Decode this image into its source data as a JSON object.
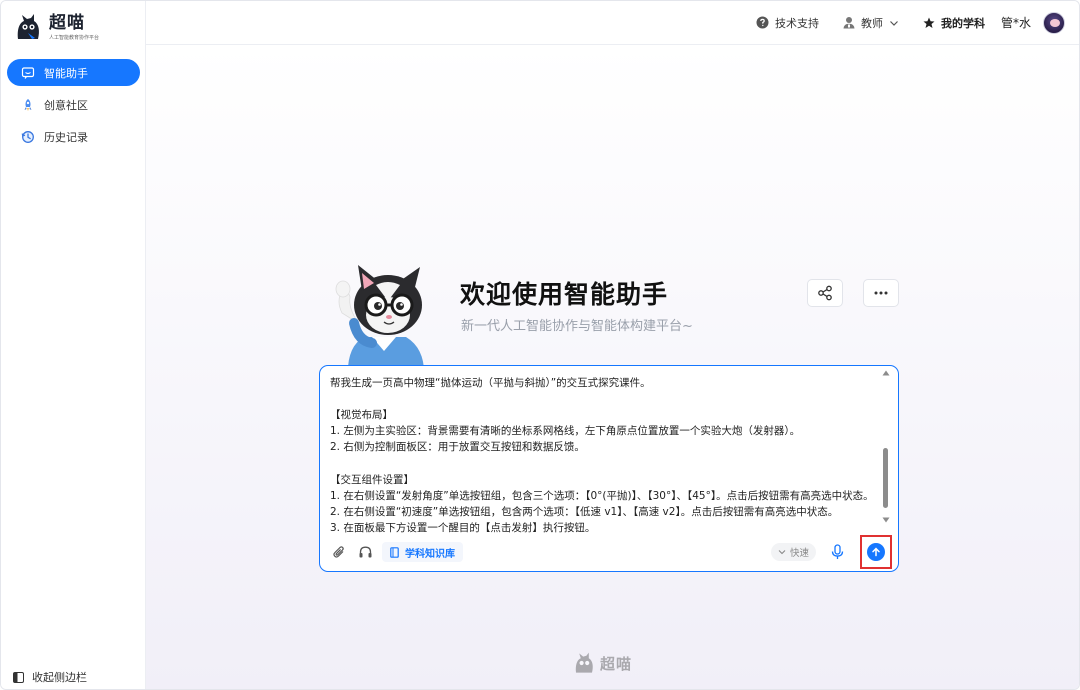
{
  "brand": {
    "name": "超喵",
    "tagline": "人工智能教育协作平台"
  },
  "sidebar": {
    "items": [
      {
        "label": "智能助手",
        "icon": "chat-icon",
        "active": true
      },
      {
        "label": "创意社区",
        "icon": "rocket-icon",
        "active": false
      },
      {
        "label": "历史记录",
        "icon": "history-icon",
        "active": false
      }
    ],
    "collapse_label": "收起侧边栏"
  },
  "topbar": {
    "support_label": "技术支持",
    "role_label": "教师",
    "subject_label": "我的学科",
    "user_name": "管*水"
  },
  "welcome": {
    "title": "欢迎使用智能助手",
    "subtitle": "新一代人工智能协作与智能体构建平台~"
  },
  "composer": {
    "text": "帮我生成一页高中物理“抛体运动（平抛与斜抛）”的交互式探究课件。\n\n【视觉布局】\n1. 左侧为主实验区：背景需要有清晰的坐标系网格线，左下角原点位置放置一个实验大炮（发射器）。\n2. 右侧为控制面板区：用于放置交互按钮和数据反馈。\n\n【交互组件设置】\n1. 在右侧设置“发射角度”单选按钮组，包含三个选项：【0°(平抛)】、【30°】、【45°】。点击后按钮需有高亮选中状态。\n2. 在右侧设置“初速度”单选按钮组，包含两个选项：【低速 v1】、【高速 v2】。点击后按钮需有高亮选中状态。\n3. 在面板最下方设置一个醒目的【点击发射】执行按钮。",
    "knowledge_chip": "学科知识库",
    "speed_label": "快速"
  },
  "colors": {
    "accent": "#1677ff",
    "highlight_border": "#e03131"
  }
}
